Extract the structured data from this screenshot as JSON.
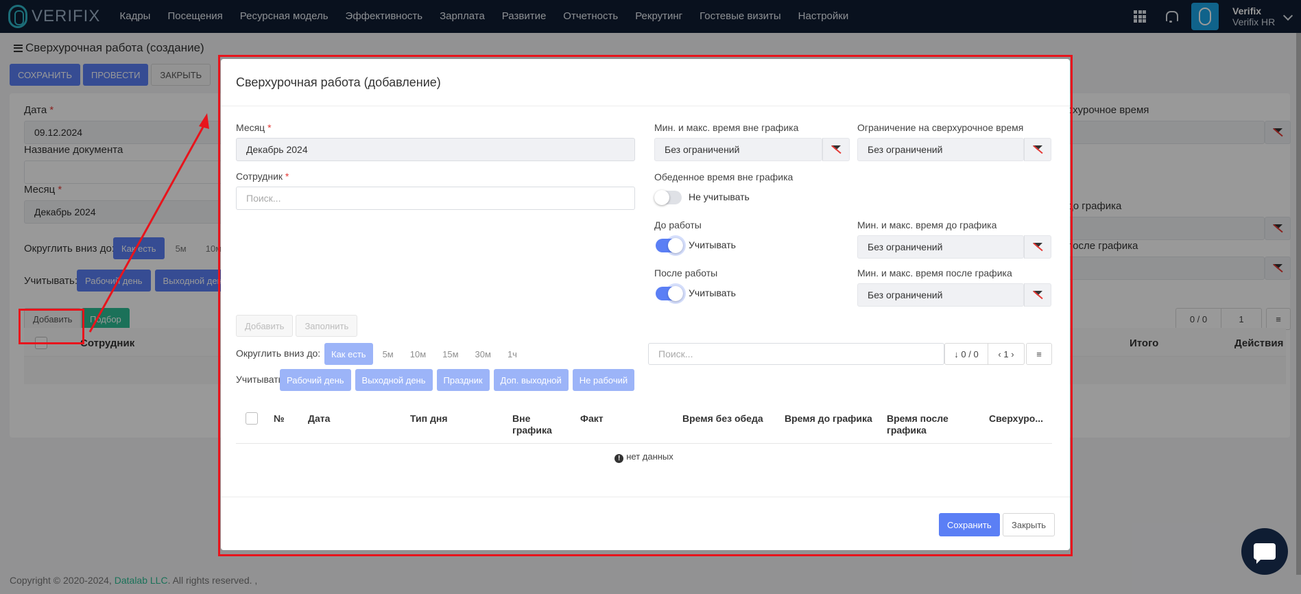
{
  "navbar": {
    "logo_text": "VERIFIX",
    "menu": [
      "Кадры",
      "Посещения",
      "Ресурсная модель",
      "Эффективность",
      "Зарплата",
      "Развитие",
      "Отчетность",
      "Рекрутинг",
      "Гостевые визиты",
      "Настройки"
    ],
    "user_name": "Verifix",
    "user_company": "Verifix HR"
  },
  "page": {
    "title": "Сверхурочная работа (создание)",
    "actions": {
      "save": "СОХРАНИТЬ",
      "post": "ПРОВЕСТИ",
      "close": "ЗАКРЫТЬ"
    },
    "date_label": "Дата",
    "date_value": "09.12.2024",
    "doc_name_label": "Название документа",
    "month_label": "Месяц",
    "month_value": "Декабрь 2024",
    "round_label": "Округлить вниз до:",
    "round_options": [
      "Как есть",
      "5м",
      "10м"
    ],
    "count_label": "Учитывать:",
    "count_options": [
      "Рабочий день",
      "Выходной день"
    ],
    "add_button": "Добавить",
    "pick_button": "Подбор",
    "right_labels": [
      "рхурочное время",
      "до графика",
      "после графика"
    ],
    "pager_count": "0 / 0",
    "pager_page": "1",
    "table_headers": {
      "employee": "Сотрудник",
      "total": "Итого",
      "actions": "Действия"
    }
  },
  "footer": {
    "copyright": "Copyright © 2020-2024,",
    "company": "Datalab LLC",
    "rights": ". All rights reserved. ,"
  },
  "modal": {
    "title": "Сверхурочная работа (добавление)",
    "month_label": "Месяц",
    "month_value": "Декабрь 2024",
    "employee_label": "Сотрудник",
    "employee_placeholder": "Поиск...",
    "out_of_schedule_label": "Мин. и макс. время вне графика",
    "out_of_schedule_value": "Без ограничений",
    "overtime_limit_label": "Ограничение на сверхурочное время",
    "overtime_limit_value": "Без ограничений",
    "lunch_label": "Обеденное время вне графика",
    "lunch_toggle_text": "Не учитывать",
    "before_work_label": "До работы",
    "before_work_toggle_text": "Учитывать",
    "before_schedule_label": "Мин. и макс. время до графика",
    "before_schedule_value": "Без ограничений",
    "after_work_label": "После работы",
    "after_work_toggle_text": "Учитывать",
    "after_schedule_label": "Мин. и макс. время после графика",
    "after_schedule_value": "Без ограничений",
    "add_button": "Добавить",
    "fill_button": "Заполнить",
    "round_label": "Округлить вниз до:",
    "round_options": [
      "Как есть",
      "5м",
      "10м",
      "15м",
      "30м",
      "1ч"
    ],
    "search_placeholder": "Поиск...",
    "pager_count": "0 / 0",
    "pager_page": "1",
    "count_label": "Учитывать:",
    "count_options": [
      "Рабочий день",
      "Выходной день",
      "Праздник",
      "Доп. выходной",
      "Не рабочий"
    ],
    "table_headers": [
      "№",
      "Дата",
      "Тип дня",
      "Вне графика",
      "Факт",
      "Время без обеда",
      "Время до графика",
      "Время после графика",
      "Сверхуро..."
    ],
    "no_data": "нет данных",
    "save_button": "Сохранить",
    "close_button": "Закрыть"
  }
}
